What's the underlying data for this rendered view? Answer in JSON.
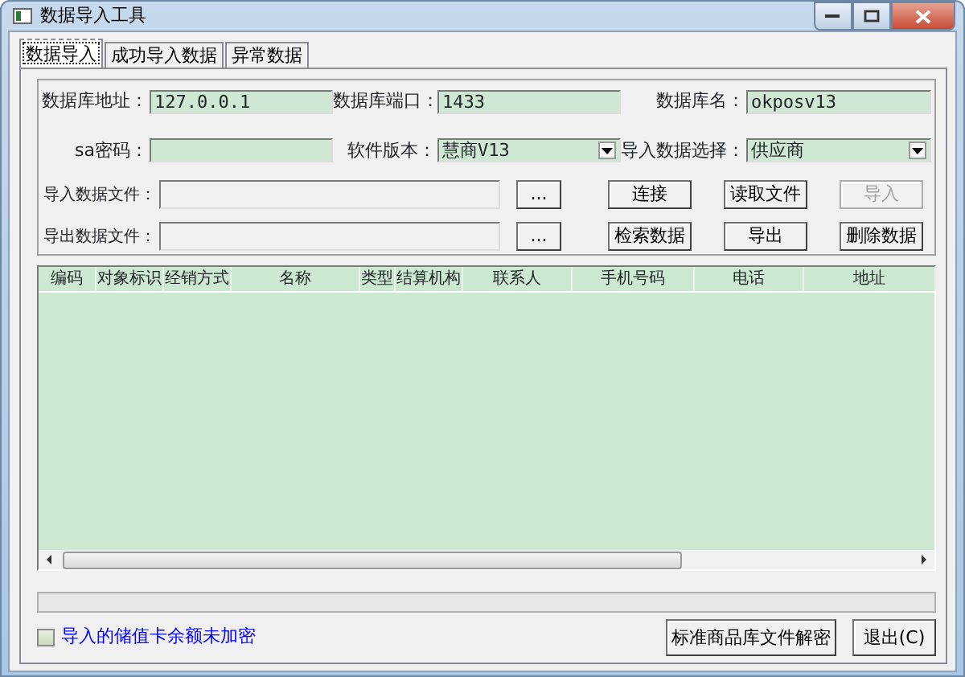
{
  "window": {
    "title": "数据导入工具"
  },
  "tabs": [
    {
      "label": "数据导入",
      "selected": true
    },
    {
      "label": "成功导入数据",
      "selected": false
    },
    {
      "label": "异常数据",
      "selected": false
    }
  ],
  "settings": [
    {
      "label": "数据库地址：",
      "value": "127.0.0.1",
      "kind": "text"
    },
    {
      "label": "数据库端口：",
      "value": "1433",
      "kind": "text"
    },
    {
      "label": "数据库名：",
      "value": "okposv13",
      "kind": "text"
    },
    {
      "label": "sa密码：",
      "kind": "password"
    },
    {
      "label": "软件版本：",
      "value": "慧商V13",
      "kind": "select"
    },
    {
      "label": "导入数据选择：",
      "value": "供应商",
      "kind": "select"
    }
  ],
  "files": [
    {
      "label": "导入数据文件：",
      "browse": "...",
      "buttons": [
        {
          "label": "连接",
          "disabled": false
        },
        {
          "label": "读取文件",
          "disabled": false
        },
        {
          "label": "导入",
          "disabled": true
        }
      ]
    },
    {
      "label": "导出数据文件：",
      "browse": "...",
      "buttons": [
        {
          "label": "检索数据",
          "disabled": false
        },
        {
          "label": "导出",
          "disabled": false
        },
        {
          "label": "删除数据",
          "disabled": false
        }
      ]
    }
  ],
  "table": {
    "columns": [
      "编码",
      "对象标识",
      "经销方式",
      "名称",
      "类型",
      "结算机构",
      "联系人",
      "手机号码",
      "电话",
      "地址"
    ]
  },
  "progress": {
    "level": 0
  },
  "encrypt_checkbox": {
    "label": "导入的储值卡余额未加密",
    "checked": false
  },
  "buttons": [
    "标准商品库文件解密",
    "退出(C)"
  ]
}
